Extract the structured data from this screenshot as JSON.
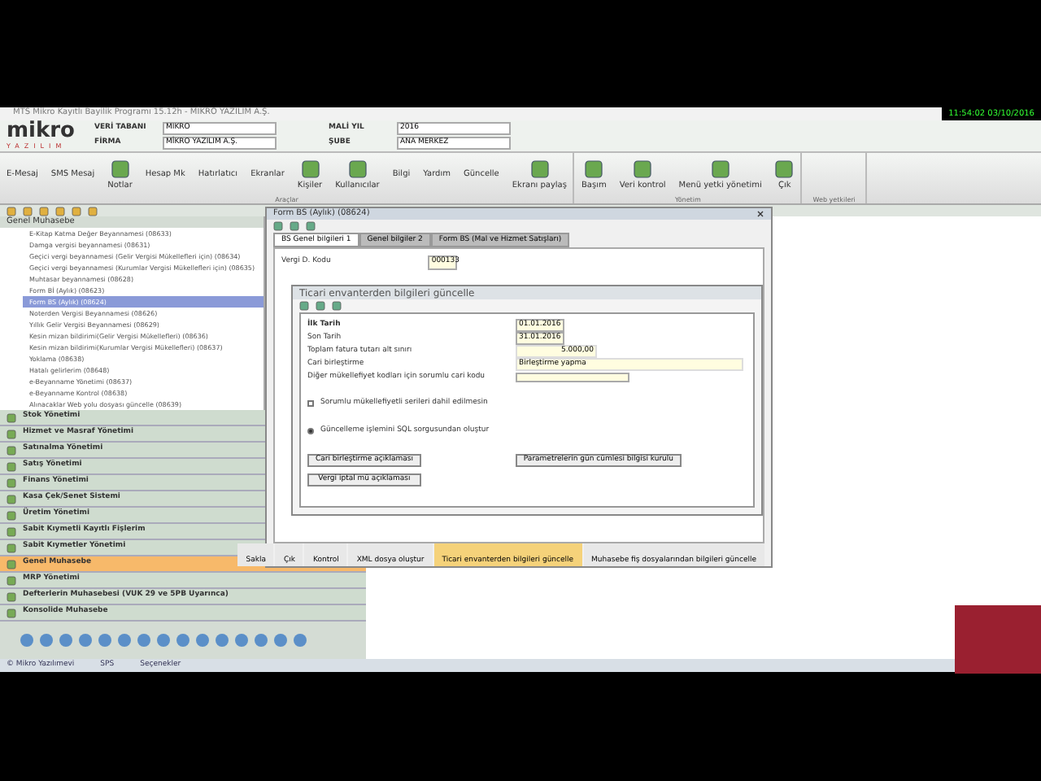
{
  "window": {
    "title": "MTS Mikro Kayıtlı Bayilik Programı 15.12h - MİKRO YAZILIM A.Ş.",
    "clock": "11:54:02 03/10/2016"
  },
  "header": {
    "logo": "mikro",
    "logo_sub": "YAZILIM",
    "fields": [
      {
        "label": "VERİ TABANI",
        "value": "MIKRO"
      },
      {
        "label": "MALİ YIL",
        "value": "2016"
      },
      {
        "label": "FİRMA",
        "value": "MİKRO YAZILIM A.Ş."
      },
      {
        "label": "ŞUBE",
        "value": "ANA MERKEZ"
      }
    ]
  },
  "ribbon": {
    "groups": [
      {
        "caption": "Araçlar",
        "items": [
          {
            "label": "E-Mesaj",
            "kind": "small"
          },
          {
            "label": "SMS Mesaj",
            "kind": "small"
          },
          {
            "label": "Notlar",
            "kind": "large"
          },
          {
            "label": "Hesap Mk",
            "kind": "small"
          },
          {
            "label": "Hatırlatıcı",
            "kind": "small"
          },
          {
            "label": "Ekranlar",
            "kind": "small"
          },
          {
            "label": "Kişiler",
            "kind": "large"
          },
          {
            "label": "Kullanıcılar",
            "kind": "large"
          },
          {
            "label": "Bilgi",
            "kind": "small"
          },
          {
            "label": "Yardım",
            "kind": "small"
          },
          {
            "label": "Güncelle",
            "kind": "small"
          },
          {
            "label": "Ekranı paylaş",
            "kind": "large"
          }
        ]
      },
      {
        "caption": "Yönetim",
        "items": [
          {
            "label": "Başım",
            "kind": "large"
          },
          {
            "label": "Veri kontrol",
            "kind": "large"
          },
          {
            "label": "Menü yetki yönetimi",
            "kind": "large"
          },
          {
            "label": "Çık",
            "kind": "large"
          }
        ]
      },
      {
        "caption": "Web yetkileri"
      }
    ]
  },
  "tree": {
    "title": "Genel Muhasebe",
    "items": [
      {
        "label": "E-Kitap Katma Değer Beyannamesi (08633)",
        "selected": false
      },
      {
        "label": "Damga vergisi beyannamesi (08631)",
        "selected": false
      },
      {
        "label": "Geçici vergi beyannamesi (Gelir Vergisi Mükellefleri için) (08634)",
        "selected": false
      },
      {
        "label": "Geçici vergi beyannamesi (Kurumlar Vergisi Mükellefleri için) (08635)",
        "selected": false
      },
      {
        "label": "Muhtasar beyannamesi (08628)",
        "selected": false
      },
      {
        "label": "Form Bİ (Aylık) (08623)",
        "selected": false
      },
      {
        "label": "Form BS (Aylık) (08624)",
        "selected": true
      },
      {
        "label": "Noterden Vergisi Beyannamesi (08626)",
        "selected": false
      },
      {
        "label": "Yıllık Gelir Vergisi Beyannamesi (08629)",
        "selected": false
      },
      {
        "label": "Kesin mizan bildirimi(Gelir Vergisi Mükellefleri) (08636)",
        "selected": false
      },
      {
        "label": "Kesin mizan bildirimi(Kurumlar Vergisi Mükellefleri) (08637)",
        "selected": false
      },
      {
        "label": "Yoklama (08638)",
        "selected": false
      },
      {
        "label": "Hatalı gelirlerim (08648)",
        "selected": false
      },
      {
        "label": "e-Beyanname Yönetimi (08637)",
        "selected": false
      },
      {
        "label": "e-Beyanname Kontrol (08638)",
        "selected": false
      },
      {
        "label": "Alınacaklar Web yolu dosyası güncelle (08639)",
        "selected": false
      }
    ]
  },
  "modules": [
    {
      "label": "Stok Yönetimi",
      "selected": false
    },
    {
      "label": "Hizmet ve Masraf Yönetimi",
      "selected": false
    },
    {
      "label": "Satınalma Yönetimi",
      "selected": false
    },
    {
      "label": "Satış Yönetimi",
      "selected": false
    },
    {
      "label": "Finans Yönetimi",
      "selected": false
    },
    {
      "label": "Kasa Çek/Senet Sistemi",
      "selected": false
    },
    {
      "label": "Üretim Yönetimi",
      "selected": false
    },
    {
      "label": "Sabit Kıymetli Kayıtlı Fişlerim",
      "selected": false
    },
    {
      "label": "Sabit Kıymetler Yönetimi",
      "selected": false
    },
    {
      "label": "Genel Muhasebe",
      "selected": true
    },
    {
      "label": "MRP Yönetimi",
      "selected": false
    },
    {
      "label": "Defterlerin Muhasebesi (VUK 29 ve 5PB Uyarınca)",
      "selected": false
    },
    {
      "label": "Konsolide Muhasebe",
      "selected": false
    }
  ],
  "status_bar": {
    "items": [
      "© Mikro Yazılımevi",
      "SPS",
      "Seçenekler"
    ]
  },
  "form": {
    "title": "Form BS (Aylık) (08624)",
    "tabs": [
      {
        "label": "BS Genel bilgileri 1",
        "selected": true
      },
      {
        "label": "Genel bilgiler 2",
        "selected": false
      },
      {
        "label": "Form BS (Mal ve Hizmet Satışları)",
        "selected": false
      }
    ],
    "fields": [
      {
        "label": "Vergi D. Kodu",
        "value": "000133"
      }
    ],
    "buttons": [
      {
        "label": "Sakla",
        "selected": false
      },
      {
        "label": "Çık",
        "selected": false
      },
      {
        "label": "Kontrol",
        "selected": false
      },
      {
        "label": "XML dosya oluştur",
        "selected": false
      },
      {
        "label": "Ticari envanterden bilgileri güncelle",
        "selected": true
      },
      {
        "label": "Muhasebe fiş dosyalarından bilgileri güncelle",
        "selected": false
      }
    ]
  },
  "dialog": {
    "title": "Ticari envanterden bilgileri güncelle",
    "rows": [
      {
        "label": "İlk Tarih",
        "kind": "date",
        "value": "01.01.2016"
      },
      {
        "label": "Son Tarih",
        "kind": "date",
        "value": "31.01.2016"
      },
      {
        "label": "Toplam fatura tutarı alt sınırı",
        "kind": "amount",
        "value": "5.000,00"
      },
      {
        "label": "Cari birleştirme",
        "kind": "text",
        "value": "Birleştirme yapma"
      },
      {
        "label": "Diğer mükellefiyet kodları için sorumlu cari kodu",
        "kind": "combo",
        "value": ""
      }
    ],
    "checkbox": {
      "label": "Sorumlu mükellefiyetli serileri dahil edilmesin",
      "checked": false
    },
    "radio": {
      "label": "Güncelleme işlemini SQL sorgusundan oluştur",
      "selected": true
    },
    "buttons": [
      "Cari birleştirme açıklaması",
      "Parametrelerin gün cümlesi bilgisi kurulu",
      "Vergi iptal mü açıklaması"
    ]
  }
}
